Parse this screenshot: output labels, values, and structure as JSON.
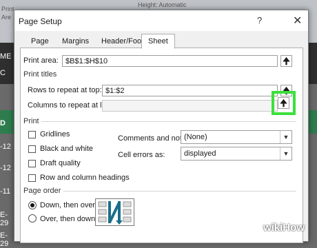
{
  "background": {
    "ribbon_texts": [
      "Print",
      "Are",
      "Height: Automatic"
    ],
    "row_labels": [
      "ME",
      "C",
      "D",
      "-12",
      "-12",
      "-11",
      "E-29",
      "E-29"
    ]
  },
  "dialog": {
    "title": "Page Setup",
    "help_glyph": "?",
    "close_glyph": "✕",
    "tabs": [
      "Page",
      "Margins",
      "Header/Footer",
      "Sheet"
    ],
    "active_tab": "Sheet",
    "print_area": {
      "label": "Print area:",
      "value": "$B$1:$H$10"
    },
    "print_titles": {
      "section_label": "Print titles",
      "rows_label": "Rows to repeat at top:",
      "rows_value": "$1:$2",
      "cols_label": "Columns to repeat at left:",
      "cols_value": ""
    },
    "print": {
      "section_label": "Print",
      "checkboxes": [
        "Gridlines",
        "Black and white",
        "Draft quality",
        "Row and column headings"
      ],
      "comments_label": "Comments and notes:",
      "comments_value": "(None)",
      "errors_label": "Cell errors as:",
      "errors_value": "displayed"
    },
    "page_order": {
      "section_label": "Page order",
      "options": [
        "Down, then over",
        "Over, then down"
      ],
      "selected": "Down, then over"
    }
  },
  "collapse_arrow": "🠉",
  "highlight_color": "#3ce03c",
  "watermark": "wikiHow"
}
